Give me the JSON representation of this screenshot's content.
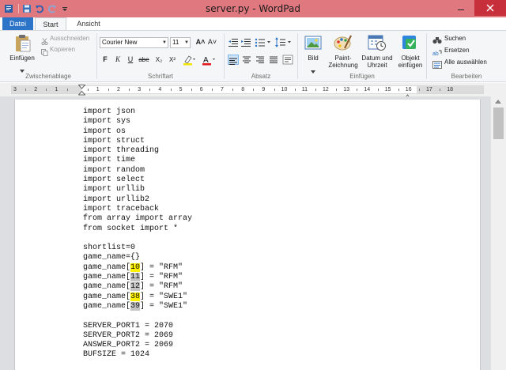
{
  "window": {
    "title": "server.py - WordPad"
  },
  "tabs": [
    {
      "label": "Datei",
      "active": false
    },
    {
      "label": "Start",
      "active": true
    },
    {
      "label": "Ansicht",
      "active": false
    }
  ],
  "ribbon": {
    "clipboard": {
      "group_label": "Zwischenablage",
      "paste": "Einfügen",
      "cut": "Ausschneiden",
      "copy": "Kopieren"
    },
    "font": {
      "group_label": "Schriftart",
      "family": "Courier New",
      "size": "11",
      "bold": "F",
      "italic": "K",
      "underline": "U",
      "strike": "abe",
      "subscript": "X₂",
      "superscript": "X²",
      "grow": "A˄",
      "shrink": "A˅",
      "text_color": "A"
    },
    "paragraph": {
      "group_label": "Absatz"
    },
    "insert": {
      "group_label": "Einfügen",
      "picture": "Bild",
      "paint_line1": "Paint-",
      "paint_line2": "Zeichnung",
      "datetime_line1": "Datum und",
      "datetime_line2": "Uhrzeit",
      "object_line1": "Objekt",
      "object_line2": "einfügen"
    },
    "editing": {
      "group_label": "Bearbeiten",
      "find": "Suchen",
      "replace": "Ersetzen",
      "select_all": "Alle auswählen"
    }
  },
  "ruler": {
    "labels": [
      "3",
      "2",
      "1",
      "",
      "1",
      "2",
      "3",
      "4",
      "5",
      "6",
      "7",
      "8",
      "9",
      "10",
      "11",
      "12",
      "13",
      "14",
      "15",
      "16",
      "17",
      "18"
    ]
  },
  "document": {
    "lines": [
      [
        {
          "t": "import json"
        }
      ],
      [
        {
          "t": "import sys"
        }
      ],
      [
        {
          "t": "import os"
        }
      ],
      [
        {
          "t": "import struct"
        }
      ],
      [
        {
          "t": "import threading"
        }
      ],
      [
        {
          "t": "import time"
        }
      ],
      [
        {
          "t": "import random"
        }
      ],
      [
        {
          "t": "import select"
        }
      ],
      [
        {
          "t": "import urllib"
        }
      ],
      [
        {
          "t": "import urllib2"
        }
      ],
      [
        {
          "t": "import traceback"
        }
      ],
      [
        {
          "t": "from array import array"
        }
      ],
      [
        {
          "t": "from socket import *"
        }
      ],
      [
        {
          "t": ""
        }
      ],
      [
        {
          "t": "shortlist=0"
        }
      ],
      [
        {
          "t": "game_name={}"
        }
      ],
      [
        {
          "t": "game_name["
        },
        {
          "t": "10",
          "hl": "yellow"
        },
        {
          "t": "] = \"RFM\""
        }
      ],
      [
        {
          "t": "game_name["
        },
        {
          "t": "11",
          "hl": "gray"
        },
        {
          "t": "] = \"RFM\""
        }
      ],
      [
        {
          "t": "game_name["
        },
        {
          "t": "12",
          "hl": "gray"
        },
        {
          "t": "] = \"RFM\""
        }
      ],
      [
        {
          "t": "game_name["
        },
        {
          "t": "38",
          "hl": "yellow"
        },
        {
          "t": "] = \"SWE1\""
        }
      ],
      [
        {
          "t": "game_name["
        },
        {
          "t": "39",
          "hl": "gray"
        },
        {
          "t": "] = \"SWE1\""
        }
      ],
      [
        {
          "t": ""
        }
      ],
      [
        {
          "t": "SERVER_PORT1 = 2070"
        }
      ],
      [
        {
          "t": "SERVER_PORT2 = 2069"
        }
      ],
      [
        {
          "t": "ANSWER_PORT2 = 2069"
        }
      ],
      [
        {
          "t": "BUFSIZE = 1024"
        }
      ]
    ]
  },
  "colors": {
    "titlebar": "#e0797f",
    "file_tab": "#2b74c7",
    "close_button": "#c7303a",
    "highlight_yellow": "#fff200",
    "highlight_gray": "#c4c4c4"
  }
}
